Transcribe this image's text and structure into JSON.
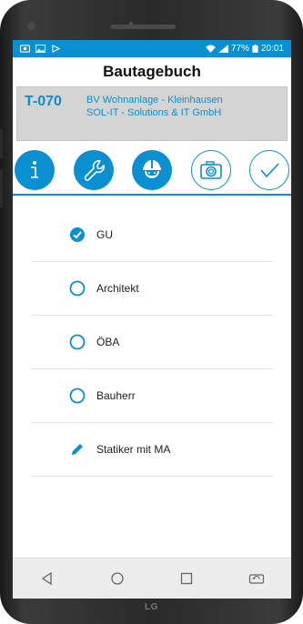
{
  "status": {
    "battery": "77%",
    "time": "20:01"
  },
  "header": {
    "title": "Bautagebuch"
  },
  "project": {
    "code": "T-070",
    "line1": "BV Wohnanlage - Kleinhausen",
    "line2": "SOL-IT - Solutions & IT GmbH"
  },
  "tabs": [
    {
      "icon": "info-icon",
      "style": "filled"
    },
    {
      "icon": "wrench-icon",
      "style": "filled"
    },
    {
      "icon": "worker-helmet-icon",
      "style": "filled"
    },
    {
      "icon": "camera-icon",
      "style": "outline"
    },
    {
      "icon": "checkmark-icon",
      "style": "outline"
    }
  ],
  "items": [
    {
      "label": "GU",
      "state": "checked"
    },
    {
      "label": "Architekt",
      "state": "unchecked"
    },
    {
      "label": "ÖBA",
      "state": "unchecked"
    },
    {
      "label": "Bauherr",
      "state": "unchecked"
    },
    {
      "label": "Statiker mit MA",
      "state": "edit"
    }
  ],
  "device": {
    "brand": "LG"
  },
  "colors": {
    "accent": "#0a8fd0",
    "project_bg": "#d4d4d4"
  }
}
